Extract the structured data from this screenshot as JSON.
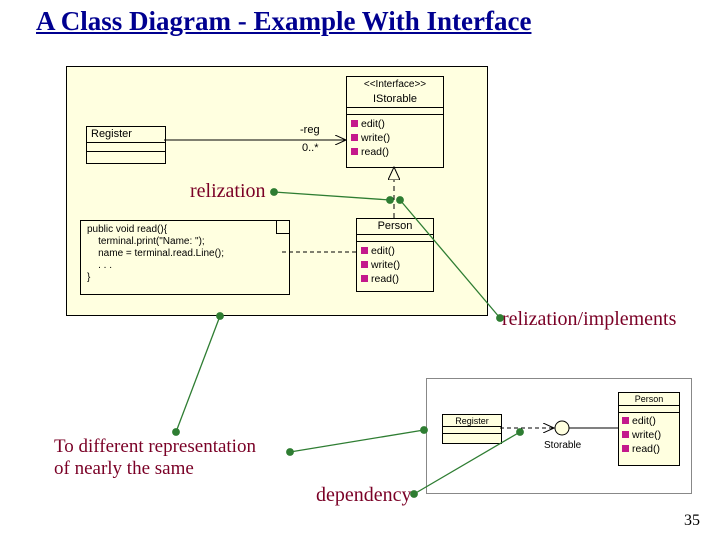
{
  "title": "A Class Diagram - Example With Interface",
  "frame1": {
    "register": {
      "name": "Register"
    },
    "assoc": {
      "role": "-reg",
      "mult": "0..*"
    },
    "istorable": {
      "stereotype": "<<Interface>>",
      "name": "IStorable",
      "ops": [
        "edit()",
        "write()",
        "read()"
      ]
    },
    "person": {
      "name": "Person",
      "ops": [
        "edit()",
        "write()",
        "read()"
      ]
    },
    "note_code": "public void read(){\n    terminal.print(\"Name: \");\n    name = terminal.read.Line();\n    . . .\n}"
  },
  "annotations": {
    "relization_top": "relization",
    "relization_impl": "relization/implements",
    "diff_repr_l1": "To different representation",
    "diff_repr_l2": "of nearly the same",
    "dependency": "dependency"
  },
  "mini": {
    "register": "Register",
    "storable": "Storable",
    "person": "Person",
    "ops": [
      "edit()",
      "write()",
      "read()"
    ]
  },
  "page_number": "35"
}
